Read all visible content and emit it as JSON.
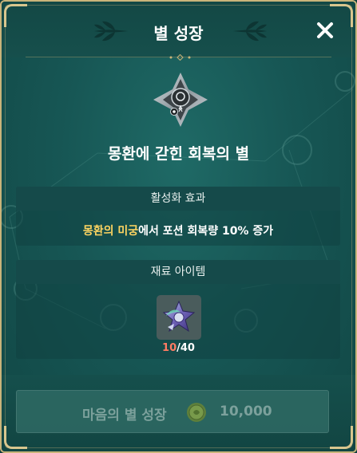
{
  "header": {
    "title": "별 성장",
    "close_icon": "close-icon"
  },
  "star": {
    "name": "몽환에 갇힌 회복의 별",
    "emblem_icon": "star-emblem-icon"
  },
  "effect": {
    "section_title": "활성화 효과",
    "highlight": "몽환의 미궁",
    "text": "에서 포션 회복량 10% 증가"
  },
  "materials": {
    "section_title": "재료 아이템",
    "item_icon": "star-fragment-icon",
    "have": "10",
    "separator": "/",
    "need": "40"
  },
  "action": {
    "label": "마음의 별 성장",
    "cost": "10,000",
    "cost_icon": "coin-icon"
  },
  "colors": {
    "accent_gold": "#c9b47a",
    "highlight_yellow": "#ffd561",
    "insufficient_red": "#ff7b62",
    "panel_teal": "#175755"
  }
}
